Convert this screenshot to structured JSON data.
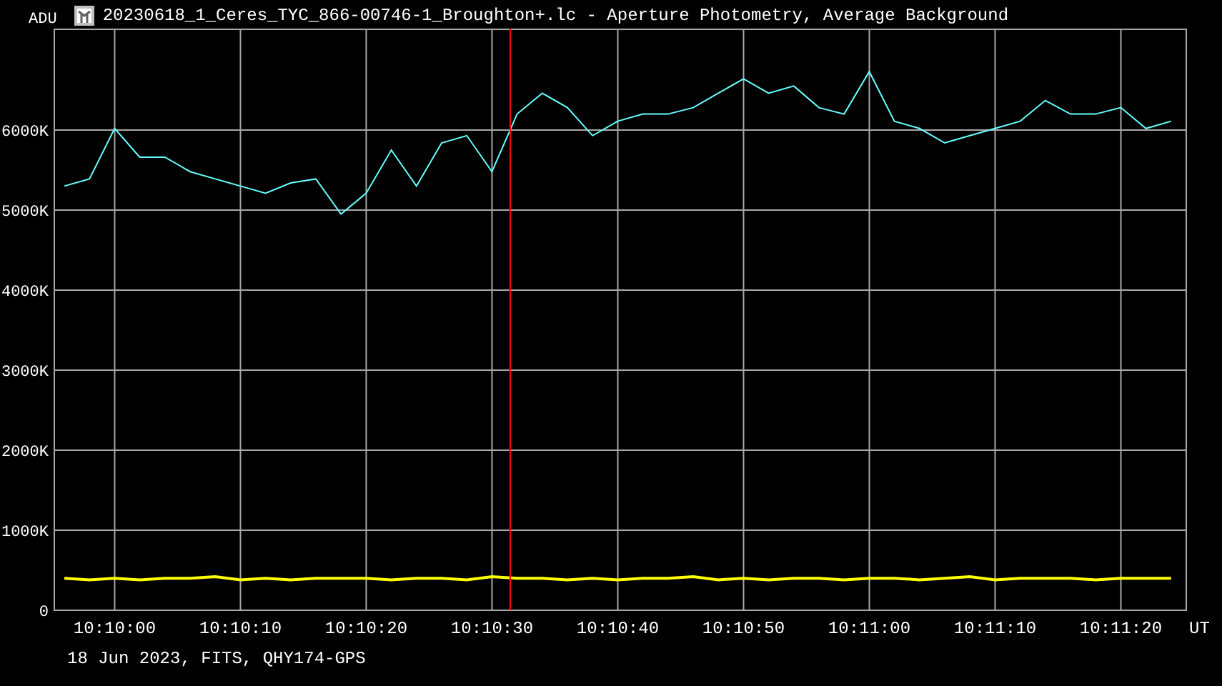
{
  "window": {
    "title": "20230618_1_Ceres_TYC_866-00746-1_Broughton+.lc - Aperture Photometry, Average Background"
  },
  "chart_data": {
    "type": "line",
    "ylabel": "ADU",
    "xlabel": "UT",
    "categories": [
      null,
      null,
      "10:10:00",
      null,
      null,
      null,
      null,
      "10:10:10",
      null,
      null,
      null,
      null,
      "10:10:20",
      null,
      null,
      null,
      null,
      "10:10:30",
      null,
      null,
      null,
      null,
      "10:10:40",
      null,
      null,
      null,
      null,
      "10:10:50",
      null,
      null,
      null,
      null,
      "10:11:00",
      null,
      null,
      null,
      null,
      "10:11:10",
      null,
      null,
      null,
      null,
      "10:11:20",
      null,
      null
    ],
    "series": [
      {
        "color": "#66ffff",
        "values": [
          5300,
          5390,
          6020,
          5660,
          5660,
          5480,
          5390,
          5300,
          5210,
          5340,
          5390,
          4950,
          5210,
          5750,
          5300,
          5840,
          5930,
          5480,
          6200,
          6460,
          6280,
          5930,
          6110,
          6200,
          6200,
          6280,
          6460,
          6640,
          6460,
          6550,
          6280,
          6200,
          6730,
          6110,
          6020,
          5840,
          5930,
          6020,
          6110,
          6370,
          6200,
          6200,
          6280,
          6020,
          6110
        ]
      },
      {
        "color": "#ffff00",
        "values": [
          400,
          380,
          400,
          380,
          400,
          400,
          420,
          380,
          400,
          380,
          400,
          400,
          400,
          380,
          400,
          400,
          380,
          420,
          400,
          400,
          380,
          400,
          380,
          400,
          400,
          420,
          380,
          400,
          380,
          400,
          400,
          380,
          400,
          400,
          380,
          400,
          420,
          380,
          400,
          400,
          400,
          380,
          400,
          400,
          400
        ]
      }
    ],
    "ylim": [
      0,
      7268
    ],
    "yticks": [
      {
        "value": 0,
        "label": "0"
      },
      {
        "value": 1000,
        "label": "1000K"
      },
      {
        "value": 2000,
        "label": "2000K"
      },
      {
        "value": 3000,
        "label": "3000K"
      },
      {
        "value": 4000,
        "label": "4000K"
      },
      {
        "value": 5000,
        "label": "5000K"
      },
      {
        "value": 6000,
        "label": "6000K"
      }
    ],
    "grid": true
  },
  "footer": "18 Jun 2023, FITS, QHY174-GPS"
}
